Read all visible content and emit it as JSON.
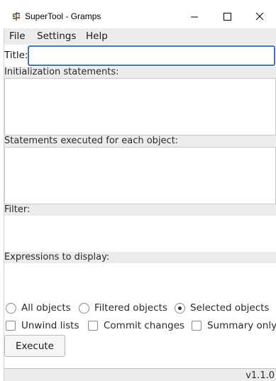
{
  "window": {
    "title": "SuperTool - Gramps",
    "icons": {
      "app": "gramps-tree-icon",
      "minimize": "minimize-icon",
      "maximize": "maximize-icon",
      "close": "close-icon"
    }
  },
  "menu": {
    "items": [
      "File",
      "Settings",
      "Help"
    ]
  },
  "form": {
    "title_label": "Title:",
    "title_value": "",
    "init_label": "Initialization statements:",
    "init_value": "",
    "each_label": "Statements executed for each object:",
    "each_value": "",
    "filter_label": "Filter:",
    "expressions_label": "Expressions to display:"
  },
  "scope": {
    "options": [
      {
        "label": "All objects",
        "checked": false
      },
      {
        "label": "Filtered objects",
        "checked": false
      },
      {
        "label": "Selected objects",
        "checked": true
      }
    ]
  },
  "toggles": {
    "options": [
      {
        "label": "Unwind lists",
        "checked": false
      },
      {
        "label": "Commit changes",
        "checked": false
      },
      {
        "label": "Summary only",
        "checked": false
      }
    ]
  },
  "actions": {
    "execute_label": "Execute"
  },
  "status": {
    "version": "v1.1.0"
  },
  "colors": {
    "focus_border": "#3a78c5",
    "section_bg": "#ececec"
  }
}
